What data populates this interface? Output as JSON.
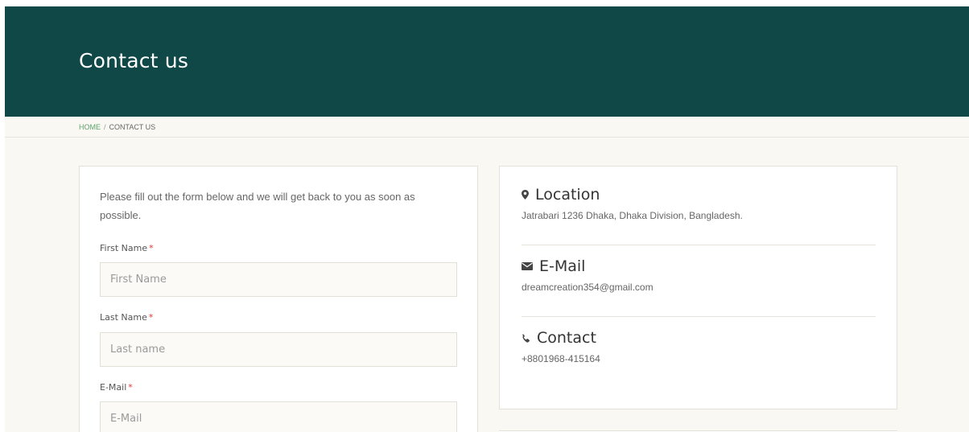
{
  "header": {
    "title": "Contact us"
  },
  "breadcrumb": {
    "home": "HOME",
    "separator": "/",
    "current": "CONTACT US"
  },
  "form": {
    "intro": "Please fill out the form below and we will get back to you as soon as possible.",
    "required_mark": "*",
    "fields": [
      {
        "label": "First Name",
        "placeholder": "First Name",
        "value": ""
      },
      {
        "label": "Last Name",
        "placeholder": "Last name",
        "value": ""
      },
      {
        "label": "E-Mail",
        "placeholder": "E-Mail",
        "value": ""
      }
    ]
  },
  "info": {
    "location": {
      "icon": "map-marker-icon",
      "title": "Location",
      "text": "Jatrabari 1236 Dhaka, Dhaka Division, Bangladesh."
    },
    "email": {
      "icon": "envelope-icon",
      "title": "E-Mail",
      "text": "dreamcreation354@gmail.com"
    },
    "contact": {
      "icon": "phone-icon",
      "title": "Contact",
      "text": "+8801968-415164"
    }
  },
  "colors": {
    "header_bg": "#104848",
    "accent_green": "#5aa36b",
    "required_red": "#e53935",
    "page_bg": "#faf8f3"
  }
}
